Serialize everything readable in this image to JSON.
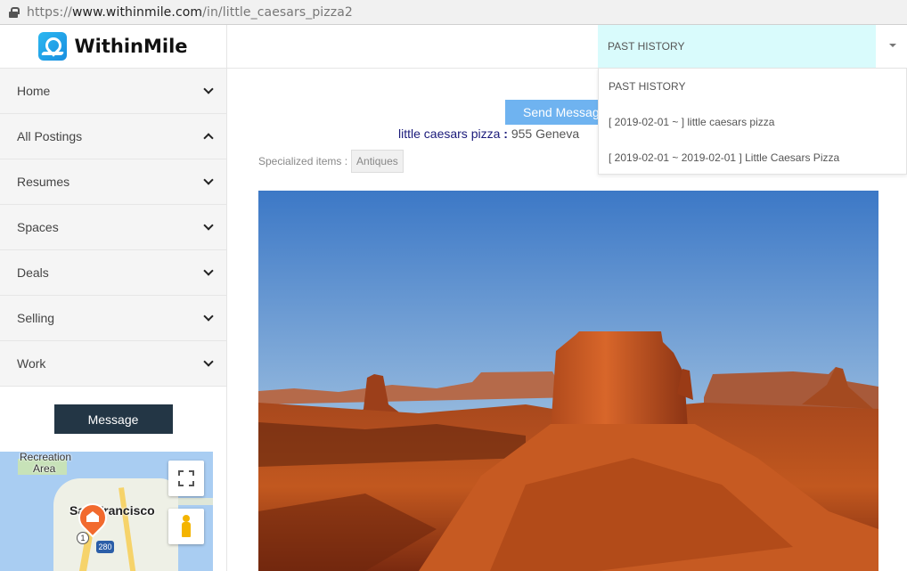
{
  "browser": {
    "url_scheme": "https://",
    "url_host": "www.withinmile.com",
    "url_path": "/in/little_caesars_pizza2"
  },
  "logo": {
    "text": "WithinMile"
  },
  "sidebar": {
    "items": [
      {
        "label": "Home",
        "expanded": false
      },
      {
        "label": "All Postings",
        "expanded": true
      },
      {
        "label": "Resumes",
        "expanded": false
      },
      {
        "label": "Spaces",
        "expanded": false
      },
      {
        "label": "Deals",
        "expanded": false
      },
      {
        "label": "Selling",
        "expanded": false
      },
      {
        "label": "Work",
        "expanded": false
      }
    ],
    "message_button": "Message"
  },
  "map": {
    "labels": {
      "recreation": "Recreation",
      "area": "Area",
      "city": "San Francisco",
      "route_1": "1",
      "route_280": "280"
    }
  },
  "history": {
    "selected": "PAST HISTORY",
    "options": [
      "PAST HISTORY",
      "[ 2019-02-01 ~ ] little caesars pizza",
      "[ 2019-02-01 ~ 2019-02-01 ] Little Caesars Pizza"
    ],
    "highlight_color": "#d9fbfc"
  },
  "main": {
    "send_button": "Send Message",
    "business_name": "little caesars pizza",
    "separator": ":",
    "address": "955 Geneva",
    "specialized_label": "Specialized items :",
    "specialized_tag": "Antiques"
  },
  "colors": {
    "accent": "#6fb3f0",
    "dark_button": "#233645"
  }
}
